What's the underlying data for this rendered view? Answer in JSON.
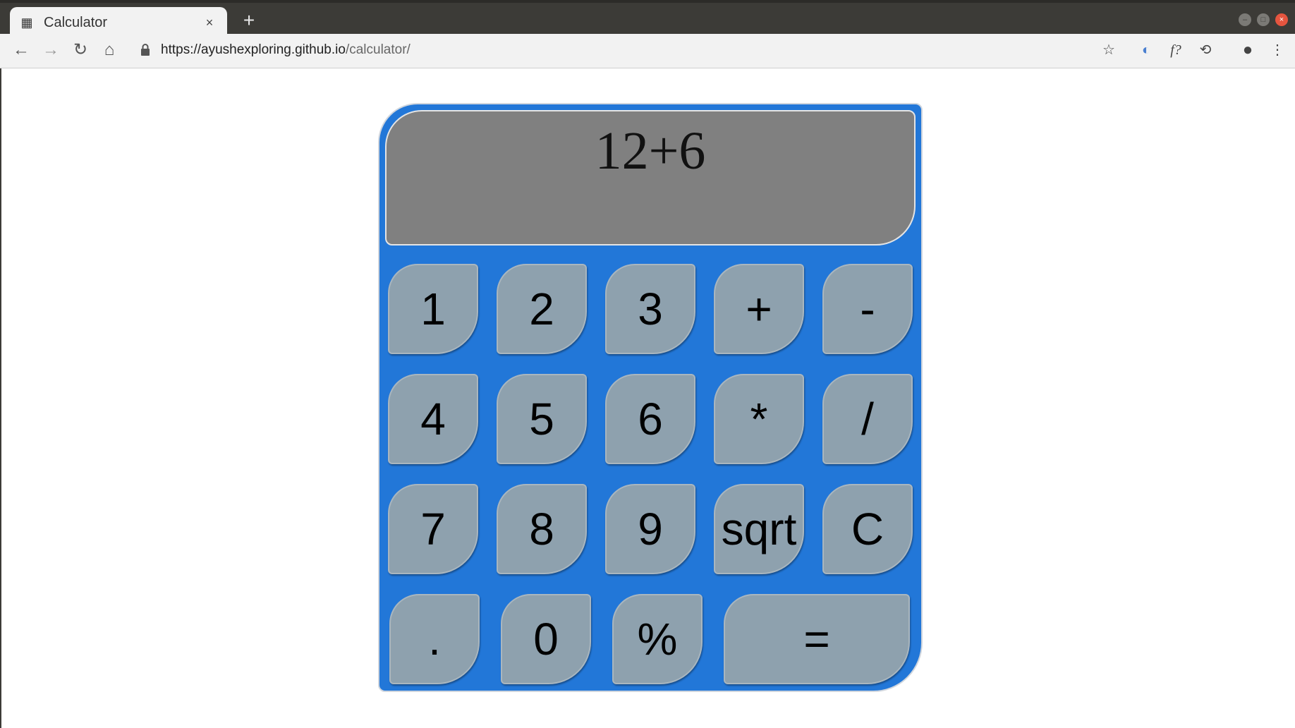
{
  "browser": {
    "tab_title": "Calculator",
    "tab_close": "×",
    "new_tab": "+",
    "url_host": "https://ayushexploring.github.io",
    "url_path": "/calculator/"
  },
  "icons": {
    "back": "arrow-left",
    "forward": "arrow-right",
    "reload": "reload",
    "home": "home",
    "lock": "lock",
    "bookmark": "star",
    "profile": "account-circle",
    "menu": "kebab-menu"
  },
  "calculator": {
    "display": "12+6",
    "keys": [
      {
        "label": "1"
      },
      {
        "label": "2"
      },
      {
        "label": "3"
      },
      {
        "label": "+"
      },
      {
        "label": "-"
      },
      {
        "label": "4"
      },
      {
        "label": "5"
      },
      {
        "label": "6"
      },
      {
        "label": "*"
      },
      {
        "label": "/"
      },
      {
        "label": "7"
      },
      {
        "label": "8"
      },
      {
        "label": "9"
      },
      {
        "label": "sqrt"
      },
      {
        "label": "C"
      },
      {
        "label": "."
      },
      {
        "label": "0"
      },
      {
        "label": "%"
      },
      {
        "label": "="
      }
    ]
  },
  "colors": {
    "calc_body": "#2277d8",
    "display_bg": "#808080",
    "key_bg": "#8ea1ae"
  }
}
